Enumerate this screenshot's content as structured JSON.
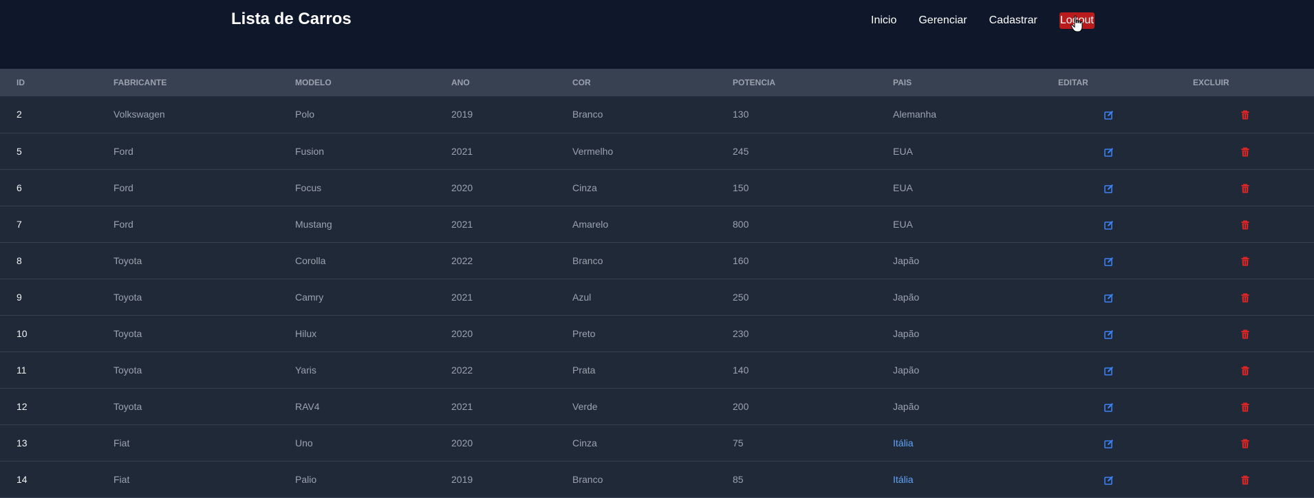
{
  "header": {
    "title": "Lista de Carros",
    "nav": [
      "Inicio",
      "Gerenciar",
      "Cadastrar",
      "Logout"
    ]
  },
  "table": {
    "columns": [
      "ID",
      "FABRICANTE",
      "MODELO",
      "ANO",
      "COR",
      "POTENCIA",
      "PAIS",
      "EDITAR",
      "EXCLUIR"
    ],
    "rows": [
      [
        "2",
        "Volkswagen",
        "Polo",
        "2019",
        "Branco",
        "130",
        "Alemanha"
      ],
      [
        "5",
        "Ford",
        "Fusion",
        "2021",
        "Vermelho",
        "245",
        "EUA"
      ],
      [
        "6",
        "Ford",
        "Focus",
        "2020",
        "Cinza",
        "150",
        "EUA"
      ],
      [
        "7",
        "Ford",
        "Mustang",
        "2021",
        "Amarelo",
        "800",
        "EUA"
      ],
      [
        "8",
        "Toyota",
        "Corolla",
        "2022",
        "Branco",
        "160",
        "Japão"
      ],
      [
        "9",
        "Toyota",
        "Camry",
        "2021",
        "Azul",
        "250",
        "Japão"
      ],
      [
        "10",
        "Toyota",
        "Hilux",
        "2020",
        "Preto",
        "230",
        "Japão"
      ],
      [
        "11",
        "Toyota",
        "Yaris",
        "2022",
        "Prata",
        "140",
        "Japão"
      ],
      [
        "12",
        "Toyota",
        "RAV4",
        "2021",
        "Verde",
        "200",
        "Japão"
      ],
      [
        "13",
        "Fiat",
        "Uno",
        "2020",
        "Cinza",
        "75",
        "Itália"
      ],
      [
        "14",
        "Fiat",
        "Palio",
        "2019",
        "Branco",
        "85",
        "Itália"
      ]
    ]
  },
  "colors": {
    "edit": "#3b82f6",
    "delete": "#dc2626",
    "logout_bg": "#b91c1c"
  },
  "icons": {
    "edit": "edit-icon",
    "delete": "trash-icon"
  }
}
